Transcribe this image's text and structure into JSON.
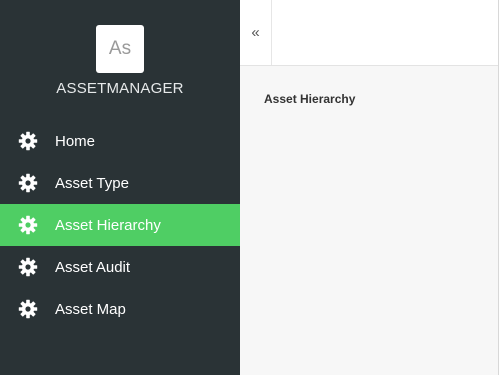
{
  "brand": {
    "logo_text": "As",
    "name": "ASSETMANAGER"
  },
  "sidebar": {
    "items": [
      {
        "label": "Home",
        "icon": "gear-icon",
        "active": false
      },
      {
        "label": "Asset Type",
        "icon": "gear-icon",
        "active": false
      },
      {
        "label": "Asset Hierarchy",
        "icon": "gear-icon",
        "active": true
      },
      {
        "label": "Asset Audit",
        "icon": "gear-icon",
        "active": false
      },
      {
        "label": "Asset Map",
        "icon": "gear-icon",
        "active": false
      }
    ]
  },
  "topbar": {
    "collapse_icon": "«"
  },
  "main": {
    "title": "Asset Hierarchy"
  },
  "colors": {
    "sidebar_bg": "#2a3336",
    "active_bg": "#4fce64",
    "content_bg": "#f7f7f7"
  }
}
